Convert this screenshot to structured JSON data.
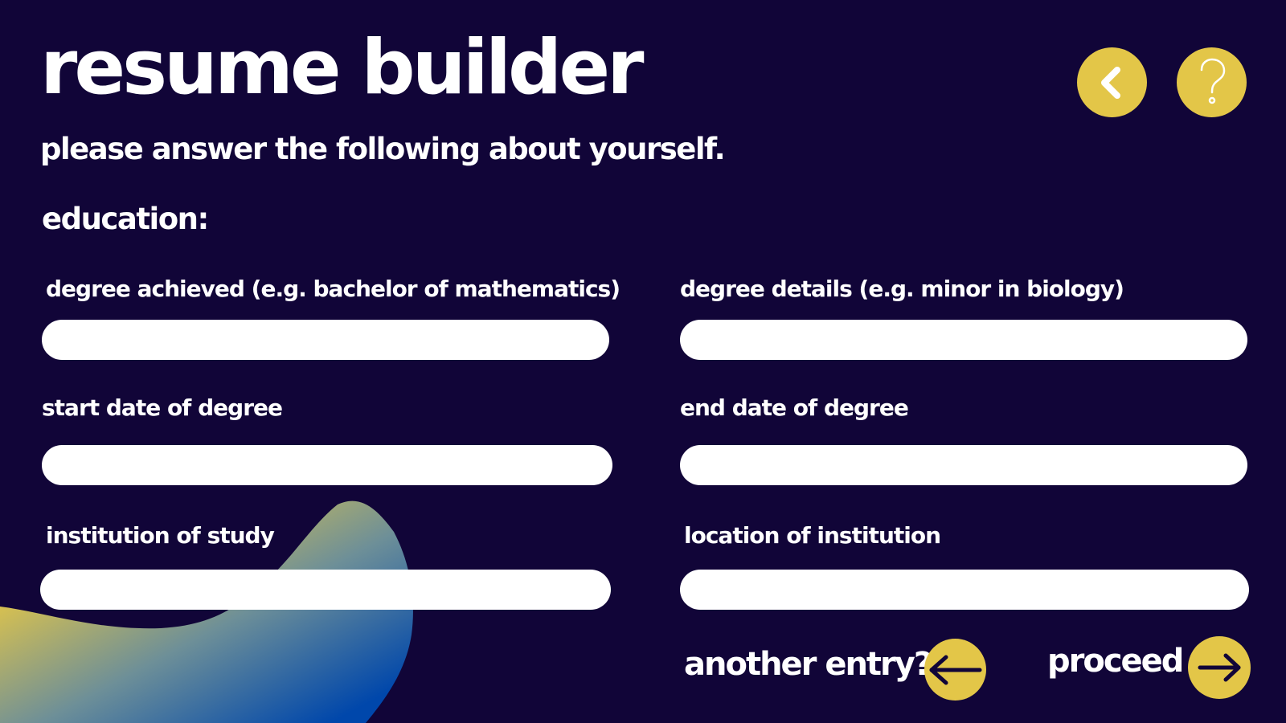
{
  "app": {
    "title": "resume builder",
    "subtitle": "please answer the following about yourself."
  },
  "section": {
    "heading": "education:"
  },
  "fields": {
    "degree_achieved": {
      "label": "degree achieved (e.g. bachelor of mathematics)",
      "value": ""
    },
    "degree_details": {
      "label": "degree details (e.g. minor in biology)",
      "value": ""
    },
    "start_date": {
      "label": "start date of degree",
      "value": ""
    },
    "end_date": {
      "label": "end date of degree",
      "value": ""
    },
    "institution": {
      "label": "institution of study",
      "value": ""
    },
    "location": {
      "label": "location of institution",
      "value": ""
    }
  },
  "actions": {
    "another_entry_label": "another entry?",
    "proceed_label": "proceed"
  },
  "icons": {
    "back": "chevron-left-icon",
    "help": "question-mark-icon",
    "another_entry": "arrow-left-icon",
    "proceed": "arrow-right-icon"
  },
  "colors": {
    "background": "#110538",
    "accent": "#e3c648",
    "text": "#ffffff",
    "input_background": "#ffffff",
    "blob_gradient_start": "#e3c648",
    "blob_gradient_end": "#0047ab"
  }
}
